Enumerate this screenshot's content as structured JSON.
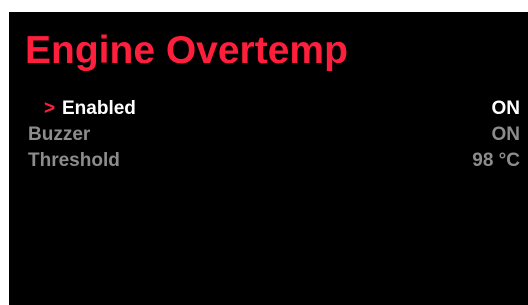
{
  "colors": {
    "background": "#000000",
    "accent": "#ff1f3d",
    "selected_text": "#ffffff",
    "dim_text": "#8c8c8c"
  },
  "screen": {
    "title": "Engine Overtemp",
    "cursor_glyph": ">"
  },
  "menu": {
    "selected_index": 0,
    "items": [
      {
        "label": "Enabled",
        "value": "ON"
      },
      {
        "label": "Buzzer",
        "value": "ON"
      },
      {
        "label": "Threshold",
        "value": "98 °C"
      }
    ]
  }
}
